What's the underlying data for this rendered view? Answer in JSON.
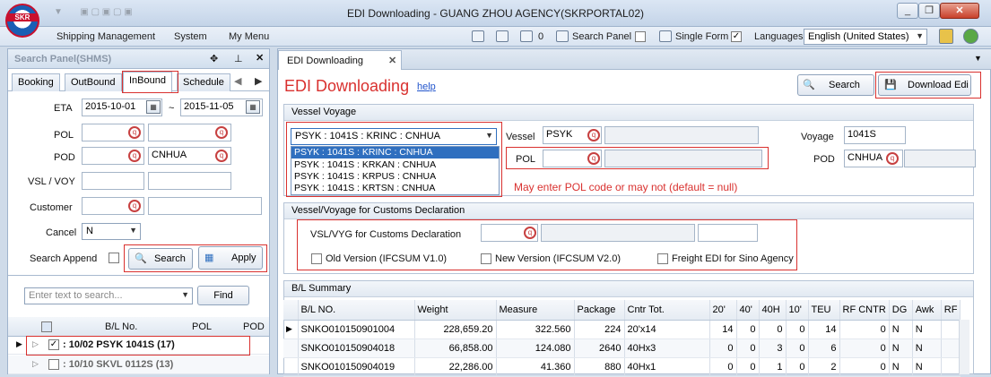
{
  "window": {
    "title": "EDI Downloading - GUANG ZHOU AGENCY(SKRPORTAL02)",
    "logo_text": "SKR"
  },
  "menu": {
    "items": [
      "Shipping Management",
      "System",
      "My Menu"
    ],
    "mail_count": "0",
    "search_panel_label": "Search Panel",
    "single_form_label": "Single Form",
    "languages_label": "Languages",
    "language_value": "English (United States)"
  },
  "left": {
    "panel_title": "Search Panel(SHMS)",
    "tabs": [
      "Booking",
      "OutBound",
      "InBound",
      "Schedule"
    ],
    "active_tab": "InBound",
    "eta_label": "ETA",
    "eta_from": "2015-10-01",
    "eta_sep": "~",
    "eta_to": "2015-11-05",
    "pol_label": "POL",
    "pod_label": "POD",
    "pod_value": "CNHUA",
    "vslvoy_label": "VSL / VOY",
    "customer_label": "Customer",
    "cancel_label": "Cancel",
    "cancel_value": "N",
    "search_append_label": "Search Append",
    "search_button": "Search",
    "apply_button": "Apply",
    "filter_placeholder": "Enter text to search...",
    "find_button": "Find",
    "grid_headers": [
      "B/L No.",
      "POL",
      "POD"
    ],
    "grid_rows": [
      {
        "text": ": 10/02 PSYK 1041S (17)",
        "checked": true
      },
      {
        "text": ": 10/10 SKVL 0112S (13)",
        "checked": false
      }
    ]
  },
  "right": {
    "doc_tab": "EDI Downloading",
    "page_title": "EDI Downloading",
    "help_link": "help",
    "search_button": "Search",
    "download_button": "Download Edi",
    "vessel_voyage_section": "Vessel  Voyage",
    "vv_selected": "PSYK : 1041S : KRINC  : CNHUA",
    "vv_options": [
      "PSYK : 1041S : KRINC  : CNHUA",
      "PSYK : 1041S : KRKAN  : CNHUA",
      "PSYK : 1041S : KRPUS  : CNHUA",
      "PSYK : 1041S : KRTSN  : CNHUA"
    ],
    "vessel_label": "Vessel",
    "vessel_value": "PSYK",
    "voyage_label": "Voyage",
    "voyage_value": "1041S",
    "pol_label": "POL",
    "pod_label": "POD",
    "pod_value": "CNHUA",
    "note": "May enter POL code or may not (default = null)",
    "customs_section": "Vessel/Voyage for Customs Declaration",
    "customs_label": "VSL/VYG for Customs Declaration",
    "old_version": "Old Version (IFCSUM V1.0)",
    "new_version": "New Version (IFCSUM V2.0)",
    "freight_edi": "Freight EDI for Sino Agency",
    "bl_section": "B/L Summary",
    "bl_headers": [
      "B/L NO.",
      "Weight",
      "Measure",
      "Package",
      "Cntr Tot.",
      "20'",
      "40'",
      "40H",
      "10'",
      "TEU",
      "RF CNTR",
      "DG",
      "Awk",
      "RF"
    ],
    "bl_rows": [
      [
        "SNKO010150901004",
        "228,659.20",
        "322.560",
        "224",
        "20'x14",
        "14",
        "0",
        "0",
        "0",
        "14",
        "0",
        "N",
        "N",
        ""
      ],
      [
        "SNKO010150904018",
        "66,858.00",
        "124.080",
        "2640",
        "40Hx3",
        "0",
        "0",
        "3",
        "0",
        "6",
        "0",
        "N",
        "N",
        ""
      ],
      [
        "SNKO010150904019",
        "22,286.00",
        "41.360",
        "880",
        "40Hx1",
        "0",
        "0",
        "1",
        "0",
        "2",
        "0",
        "N",
        "N",
        ""
      ]
    ]
  },
  "colors": {
    "accent_red": "#d9312f",
    "title_red": "#d9312f",
    "selection_blue": "#2f6fbf"
  }
}
